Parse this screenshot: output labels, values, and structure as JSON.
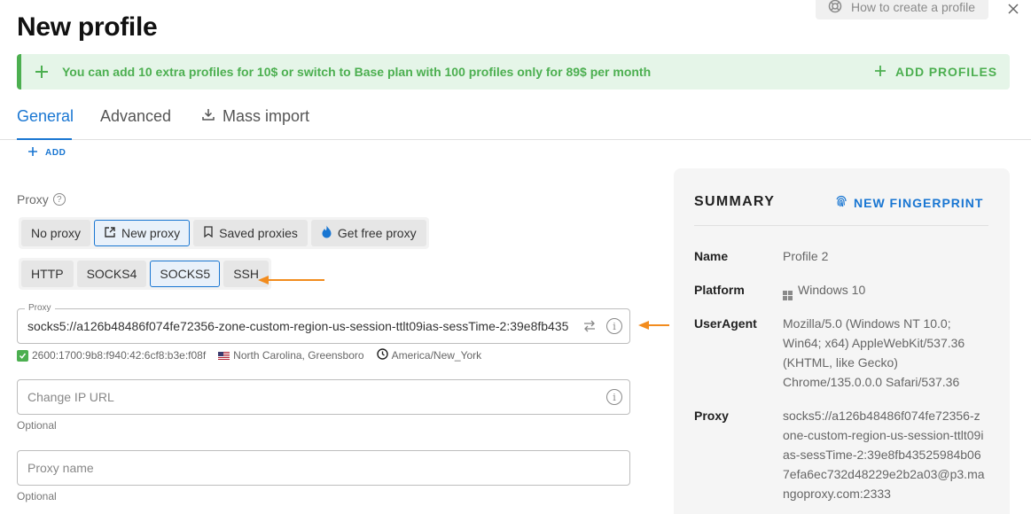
{
  "page": {
    "title": "New profile"
  },
  "header": {
    "help_label": "How to create a profile"
  },
  "banner": {
    "text": "You can add 10 extra profiles for 10$ or switch to Base plan with 100 profiles only for 89$ per month",
    "action_label": "ADD PROFILES",
    "accent": "#4caf50"
  },
  "tabs": [
    {
      "label": "General",
      "active": true
    },
    {
      "label": "Advanced",
      "active": false
    },
    {
      "label": "Mass import",
      "active": false,
      "icon": "download-icon"
    }
  ],
  "add_link": {
    "label": "ADD"
  },
  "proxy": {
    "label": "Proxy",
    "modes": [
      {
        "label": "No proxy",
        "selected": false
      },
      {
        "label": "New proxy",
        "selected": true,
        "icon": "new-tab-icon"
      },
      {
        "label": "Saved proxies",
        "selected": false,
        "icon": "bookmark-icon"
      },
      {
        "label": "Get free proxy",
        "selected": false,
        "icon": "fire-icon"
      }
    ],
    "protocols": [
      {
        "label": "HTTP",
        "selected": false
      },
      {
        "label": "SOCKS4",
        "selected": false
      },
      {
        "label": "SOCKS5",
        "selected": true
      },
      {
        "label": "SSH",
        "selected": false
      }
    ],
    "field_legend": "Proxy",
    "value": "socks5://a126b48486f074fe72356-zone-custom-region-us-session-ttlt09ias-sessTime-2:39e8fb435",
    "check": {
      "ip": "2600:1700:9b8:f940:42:6cf8:b3e:f08f",
      "location": "North Carolina, Greensboro",
      "timezone": "America/New_York"
    }
  },
  "change_ip": {
    "placeholder": "Change IP URL",
    "helper": "Optional"
  },
  "proxy_name": {
    "placeholder": "Proxy name",
    "helper": "Optional"
  },
  "summary": {
    "title": "SUMMARY",
    "fingerprint_label": "NEW FINGERPRINT",
    "rows": {
      "name": {
        "key": "Name",
        "value": "Profile 2"
      },
      "platform": {
        "key": "Platform",
        "value": "Windows 10"
      },
      "useragent": {
        "key": "UserAgent",
        "value": "Mozilla/5.0 (Windows NT 10.0; Win64; x64) AppleWebKit/537.36 (KHTML, like Gecko) Chrome/135.0.0.0 Safari/537.36"
      },
      "proxy": {
        "key": "Proxy",
        "value": "socks5://a126b48486f074fe72356-zone-custom-region-us-session-ttlt09ias-sessTime-2:39e8fb43525984b067efa6ec732d48229e2b2a03@p3.mangoproxy.com:2333"
      }
    }
  },
  "colors": {
    "primary": "#1976d2",
    "success": "#4caf50",
    "annotation_arrow": "#f28c1e"
  }
}
